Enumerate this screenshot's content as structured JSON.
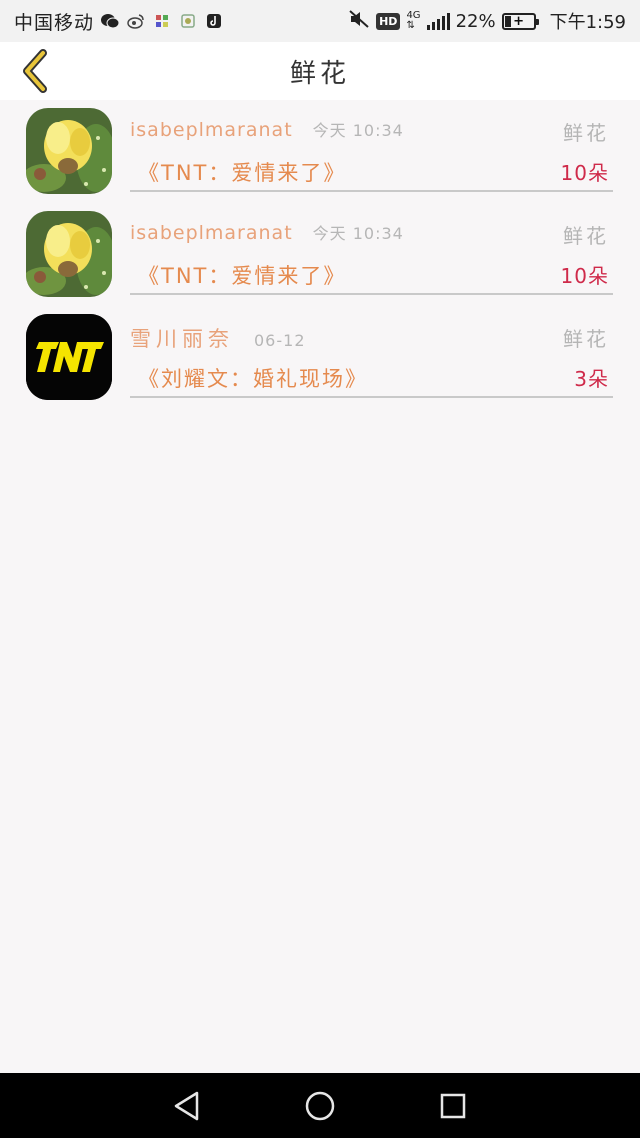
{
  "status_bar": {
    "carrier": "中国移动",
    "battery_percent": "22%",
    "battery_level": 0.22,
    "time": "下午1:59",
    "hd_label": "HD",
    "network": "4G"
  },
  "header": {
    "title": "鲜花"
  },
  "list": {
    "items": [
      {
        "username": "isabeplmaranat",
        "time": "今天 10:34",
        "category": "鲜花",
        "work": "《TNT：爱情来了》",
        "quantity": "10朵",
        "avatar": "cactus-flower"
      },
      {
        "username": "isabeplmaranat",
        "time": "今天 10:34",
        "category": "鲜花",
        "work": "《TNT：爱情来了》",
        "quantity": "10朵",
        "avatar": "cactus-flower"
      },
      {
        "username": "雪川丽奈",
        "time": "06-12",
        "category": "鲜花",
        "work": "《刘耀文：婚礼现场》",
        "quantity": "3朵",
        "avatar": "tnt-logo",
        "avatar_text": "TNT"
      }
    ]
  },
  "colors": {
    "username": "#e8a27a",
    "work_title": "#e58a4e",
    "quantity": "#cf2a4a",
    "muted": "#b5b5b5",
    "back_arrow": "#e8c53a"
  }
}
